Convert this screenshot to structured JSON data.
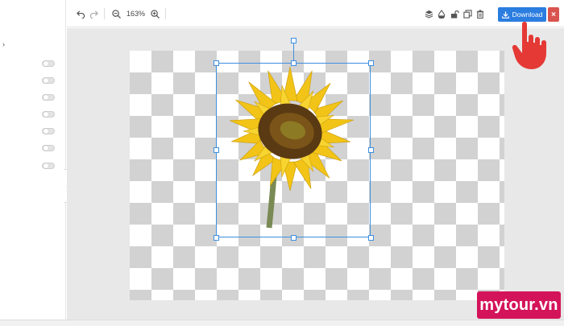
{
  "toolbar": {
    "zoom_level": "163%",
    "download_label": "Download",
    "close_label": "×"
  },
  "icons": {
    "undo": "undo-icon",
    "redo": "redo-icon",
    "zoom_out": "zoom-out-icon",
    "zoom_in": "zoom-in-icon",
    "layers": "layers-icon",
    "opacity": "opacity-drop-icon",
    "lock": "unlock-icon",
    "duplicate": "duplicate-icon",
    "delete": "trash-icon",
    "download": "download-icon"
  },
  "sidebar": {
    "expand_label": "›",
    "toggles": [
      {
        "on": false
      },
      {
        "on": false
      },
      {
        "on": false
      },
      {
        "on": false
      },
      {
        "on": false
      },
      {
        "on": false
      },
      {
        "on": false
      }
    ]
  },
  "watermark": {
    "text": "mytour.vn"
  },
  "colors": {
    "accent": "#2b7de0",
    "selection": "#3d8fe0",
    "close": "#d9534f",
    "watermark_bg": "#d4145a",
    "pointer": "#e53935"
  }
}
